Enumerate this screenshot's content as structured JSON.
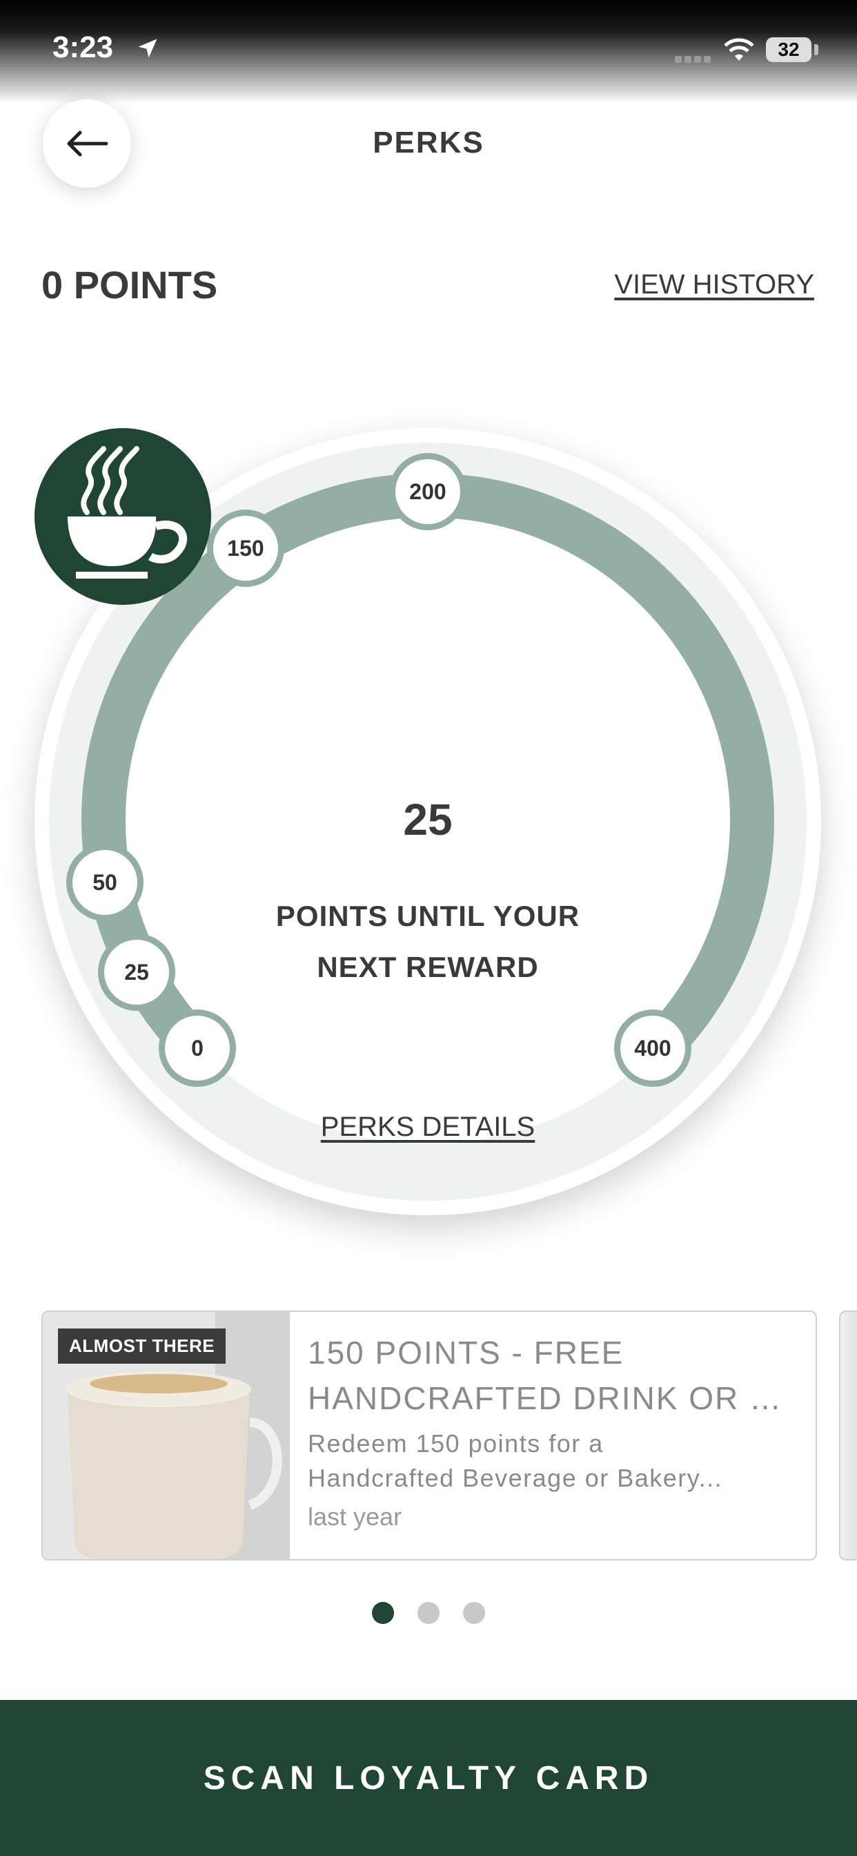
{
  "status_bar": {
    "time": "3:23",
    "battery": "32"
  },
  "header": {
    "title": "PERKS"
  },
  "summary": {
    "points_label": "0 POINTS",
    "view_history": "VIEW HISTORY"
  },
  "dial": {
    "points_until_value": "25",
    "points_until_label": "POINTS UNTIL YOUR NEXT REWARD",
    "perks_details": "PERKS DETAILS",
    "milestones": [
      "0",
      "25",
      "50",
      "150",
      "200",
      "400"
    ],
    "track_color": "#93aea3",
    "icon_color": "#1e4632"
  },
  "reward_card": {
    "badge": "ALMOST THERE",
    "title_line1": "150 POINTS - FREE",
    "title_line2": "HANDCRAFTED DRINK OR B...",
    "desc_line1": "Redeem 150 points for a",
    "desc_line2": "Handcrafted Beverage or Bakery...",
    "time": "last year"
  },
  "pager": {
    "count": 3,
    "active_index": 0
  },
  "footer": {
    "scan_button": "SCAN LOYALTY CARD"
  },
  "colors": {
    "brand_green": "#1e4632",
    "track": "#93aea3"
  }
}
